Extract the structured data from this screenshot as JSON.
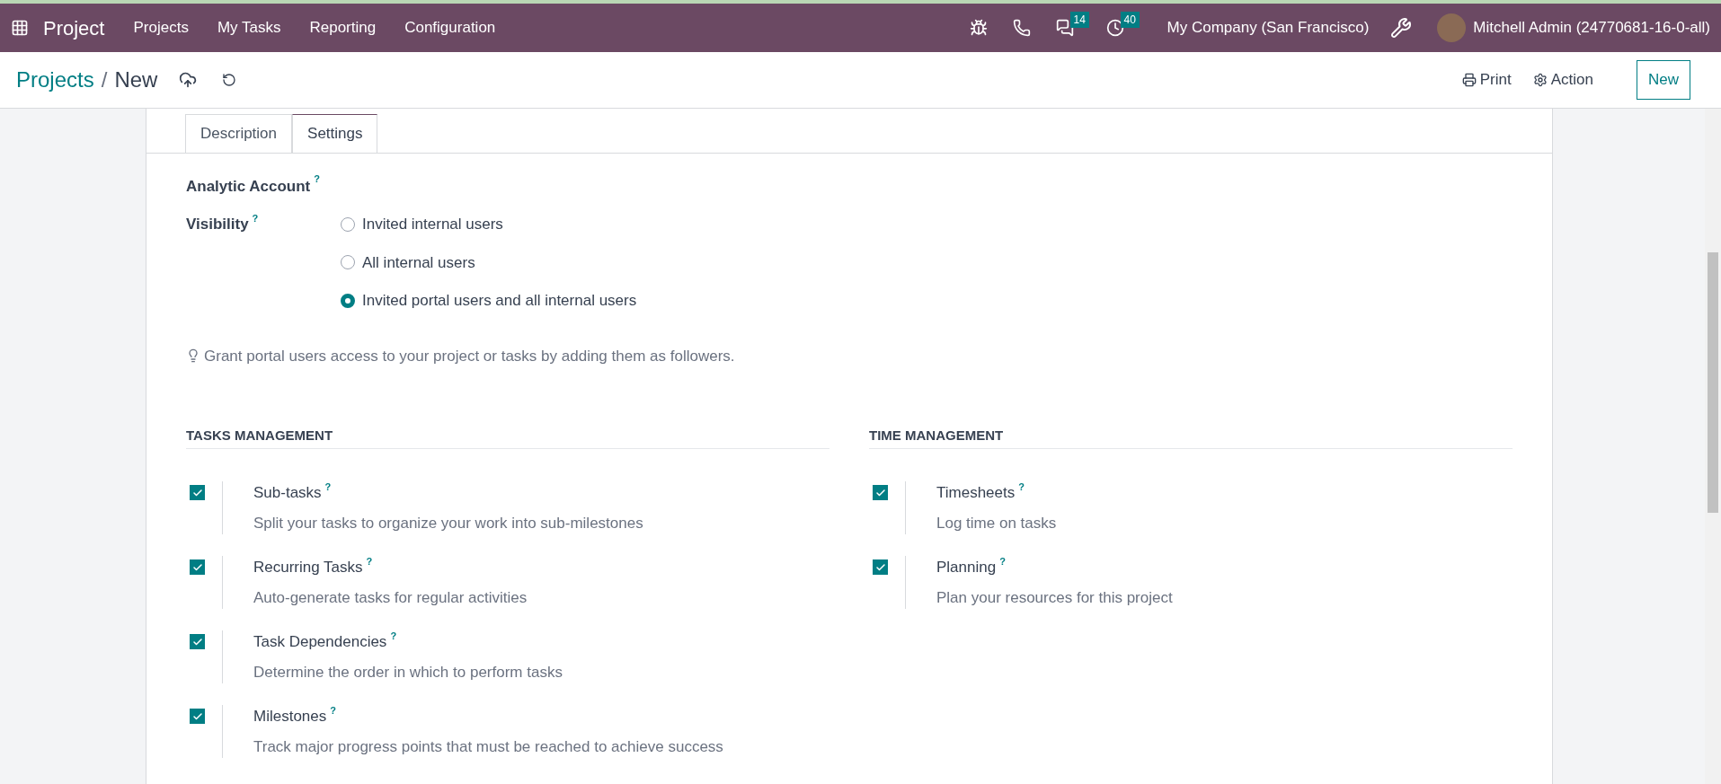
{
  "navbar": {
    "app": "Project",
    "menu": [
      "Projects",
      "My Tasks",
      "Reporting",
      "Configuration"
    ],
    "messages_badge": "14",
    "activities_badge": "40",
    "company": "My Company (San Francisco)",
    "user": "Mitchell Admin (24770681-16-0-all)"
  },
  "breadcrumb": {
    "parent": "Projects",
    "separator": "/",
    "current": "New"
  },
  "actions": {
    "print": "Print",
    "action": "Action",
    "new": "New"
  },
  "tabs": [
    {
      "label": "Description",
      "selected": false
    },
    {
      "label": "Settings",
      "selected": true
    }
  ],
  "analytic_account": {
    "label": "Analytic Account",
    "help": "?"
  },
  "visibility": {
    "label": "Visibility",
    "help": "?",
    "options": [
      {
        "label": "Invited internal users",
        "selected": false
      },
      {
        "label": "All internal users",
        "selected": false
      },
      {
        "label": "Invited portal users and all internal users",
        "selected": true
      }
    ]
  },
  "hint": "Grant portal users access to your project or tasks by adding them as followers.",
  "sections": [
    {
      "title": "TASKS MANAGEMENT",
      "settings": [
        {
          "label": "Sub-tasks",
          "help": "?",
          "description": "Split your tasks to organize your work into sub-milestones",
          "checked": true
        },
        {
          "label": "Recurring Tasks",
          "help": "?",
          "description": "Auto-generate tasks for regular activities",
          "checked": true
        },
        {
          "label": "Task Dependencies",
          "help": "?",
          "description": "Determine the order in which to perform tasks",
          "checked": true
        },
        {
          "label": "Milestones",
          "help": "?",
          "description": "Track major progress points that must be reached to achieve success",
          "checked": true
        }
      ]
    },
    {
      "title": "TIME MANAGEMENT",
      "settings": [
        {
          "label": "Timesheets",
          "help": "?",
          "description": "Log time on tasks",
          "checked": true
        },
        {
          "label": "Planning",
          "help": "?",
          "description": "Plan your resources for this project",
          "checked": true
        }
      ]
    }
  ]
}
